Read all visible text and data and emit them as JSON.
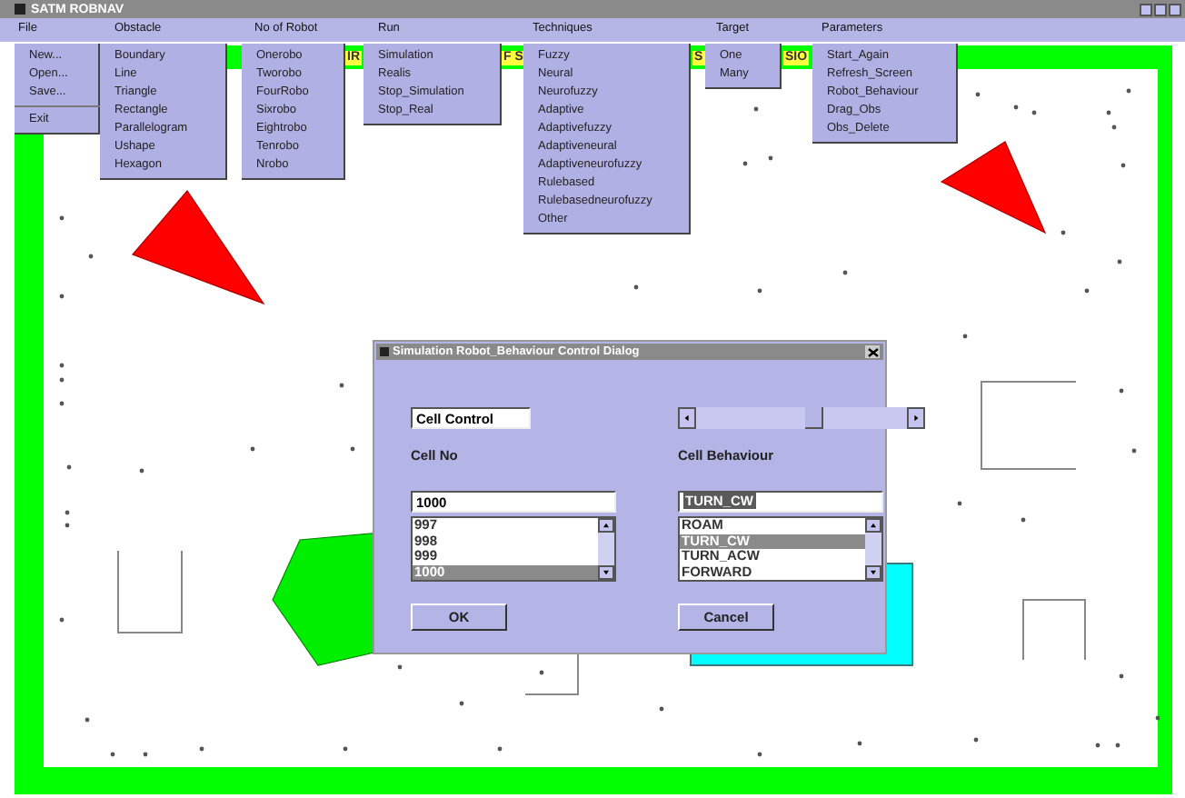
{
  "window": {
    "title": "SATM ROBNAV"
  },
  "menu_bar": [
    {
      "label": "File",
      "items": [
        {
          "kind": "item",
          "label": "New..."
        },
        {
          "kind": "item",
          "label": "Open..."
        },
        {
          "kind": "item",
          "label": "Save..."
        },
        {
          "kind": "separator"
        },
        {
          "kind": "item",
          "label": "Exit"
        }
      ]
    },
    {
      "label": "Obstacle",
      "items": [
        {
          "kind": "item",
          "label": "Boundary"
        },
        {
          "kind": "item",
          "label": "Line"
        },
        {
          "kind": "item",
          "label": "Triangle"
        },
        {
          "kind": "item",
          "label": "Rectangle"
        },
        {
          "kind": "item",
          "label": "Parallelogram"
        },
        {
          "kind": "item",
          "label": "Ushape"
        },
        {
          "kind": "item",
          "label": "Hexagon"
        }
      ]
    },
    {
      "label": "No of Robot",
      "items": [
        {
          "kind": "item",
          "label": "Onerobo"
        },
        {
          "kind": "item",
          "label": "Tworobo"
        },
        {
          "kind": "item",
          "label": "FourRobo"
        },
        {
          "kind": "item",
          "label": "Sixrobo"
        },
        {
          "kind": "item",
          "label": "Eightrobo"
        },
        {
          "kind": "item",
          "label": "Tenrobo"
        },
        {
          "kind": "item",
          "label": "Nrobo"
        }
      ]
    },
    {
      "label": "Run",
      "items": [
        {
          "kind": "item",
          "label": "Simulation"
        },
        {
          "kind": "item",
          "label": "Realis"
        },
        {
          "kind": "item",
          "label": "Stop_Simulation"
        },
        {
          "kind": "item",
          "label": "Stop_Real"
        }
      ]
    },
    {
      "label": "Techniques",
      "items": [
        {
          "kind": "item",
          "label": "Fuzzy"
        },
        {
          "kind": "item",
          "label": "Neural"
        },
        {
          "kind": "item",
          "label": "Neurofuzzy"
        },
        {
          "kind": "item",
          "label": "Adaptive"
        },
        {
          "kind": "item",
          "label": "Adaptivefuzzy"
        },
        {
          "kind": "item",
          "label": "Adaptiveneural"
        },
        {
          "kind": "item",
          "label": "Adaptiveneurofuzzy"
        },
        {
          "kind": "item",
          "label": "Rulebased"
        },
        {
          "kind": "item",
          "label": "Rulebasedneurofuzzy"
        },
        {
          "kind": "item",
          "label": "Other"
        }
      ]
    },
    {
      "label": "Target",
      "items": [
        {
          "kind": "item",
          "label": "One"
        },
        {
          "kind": "item",
          "label": "Many"
        }
      ]
    },
    {
      "label": "Parameters",
      "items": [
        {
          "kind": "item",
          "label": "Start_Again"
        },
        {
          "kind": "item",
          "label": "Refresh_Screen"
        },
        {
          "kind": "item",
          "label": "Robot_Behaviour"
        },
        {
          "kind": "item",
          "label": "Drag_Obs"
        },
        {
          "kind": "item",
          "label": "Obs_Delete"
        }
      ]
    }
  ],
  "banner_fragments": [
    "IR",
    "F S",
    "S",
    "SIO"
  ],
  "dialog": {
    "title": "Simulation Robot_Behaviour Control Dialog",
    "cell_control": {
      "value": "Cell Control"
    },
    "cell_no": {
      "label": "Cell No",
      "value": "1000",
      "options": [
        {
          "label": "997",
          "selected": false
        },
        {
          "label": "998",
          "selected": false
        },
        {
          "label": "999",
          "selected": false
        },
        {
          "label": "1000",
          "selected": true
        }
      ]
    },
    "cell_behaviour": {
      "label": "Cell Behaviour",
      "value": "TURN_CW",
      "options": [
        {
          "label": "ROAM",
          "selected": false
        },
        {
          "label": "TURN_CW",
          "selected": true
        },
        {
          "label": "TURN_ACW",
          "selected": false
        },
        {
          "label": "FORWARD",
          "selected": false
        }
      ]
    },
    "buttons": [
      "OK",
      "Cancel"
    ]
  }
}
